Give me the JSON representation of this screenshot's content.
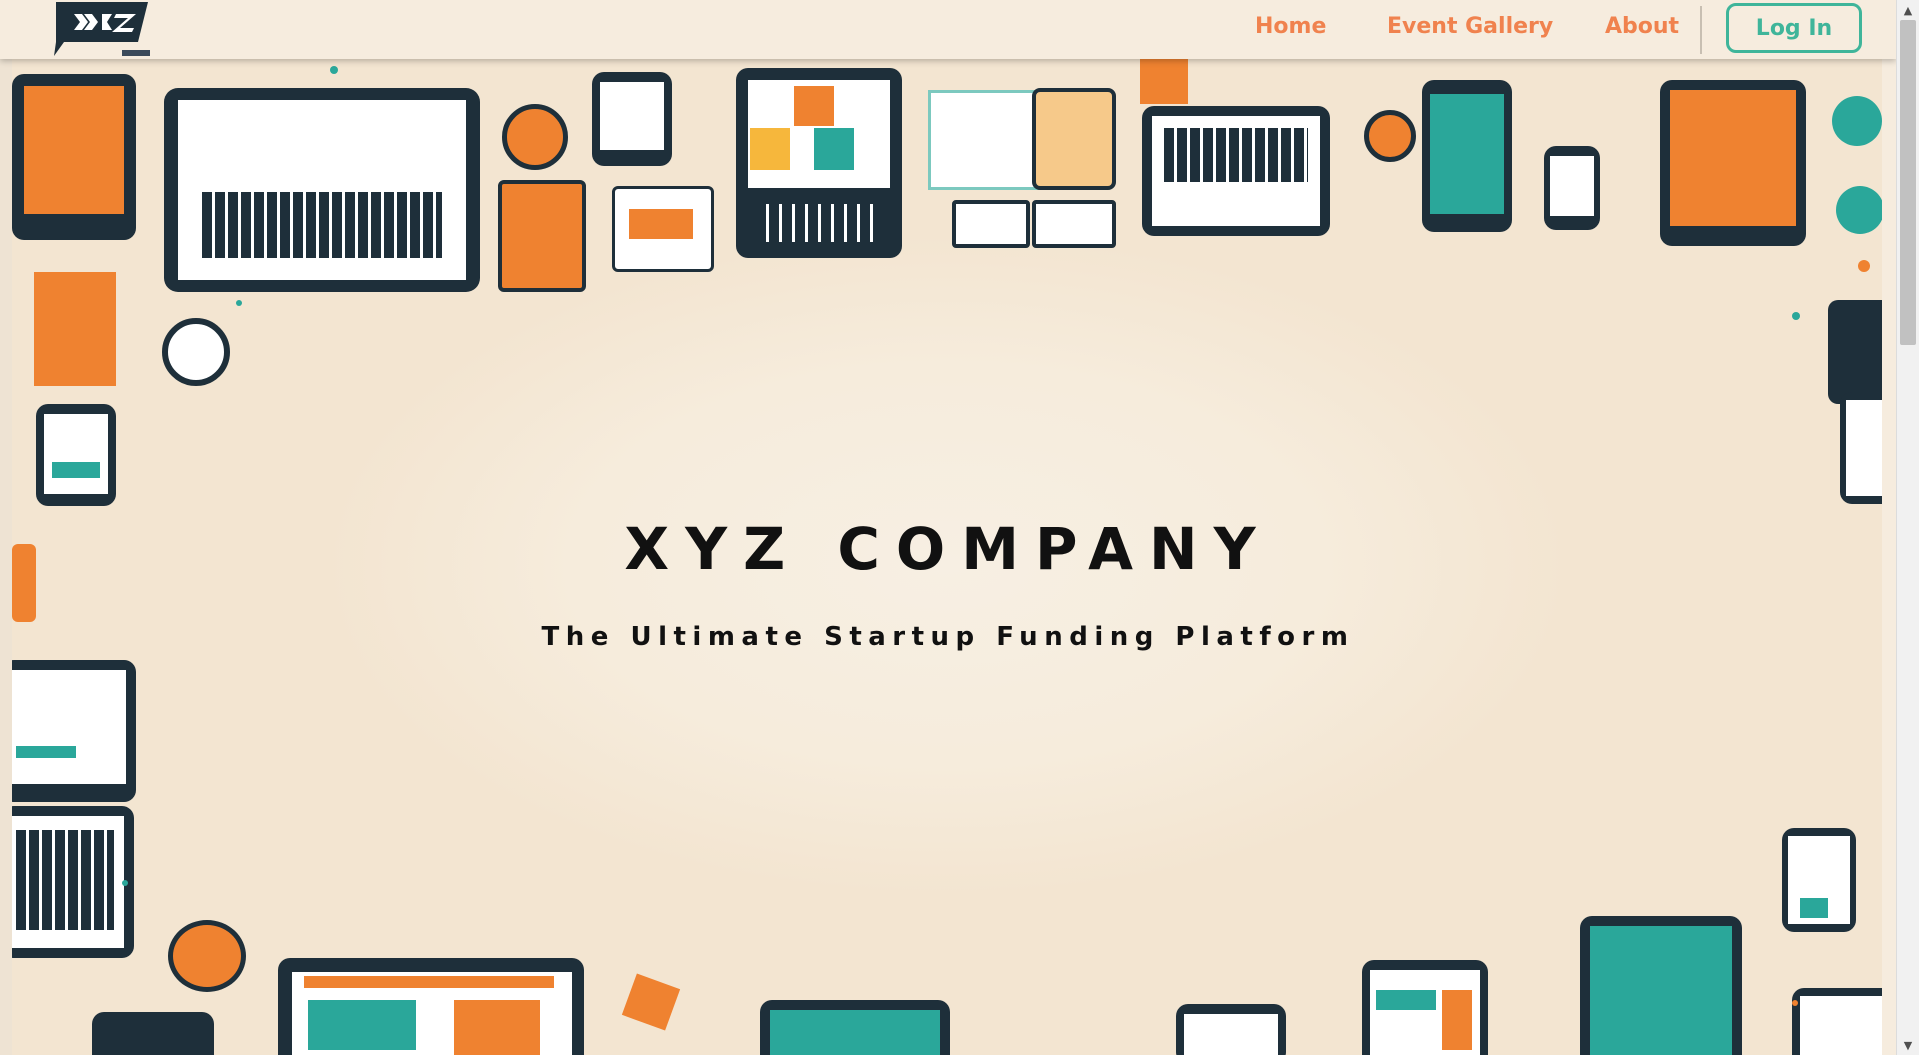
{
  "header": {
    "logo_alt": "XYZ",
    "nav": {
      "home": "Home",
      "event_gallery": "Event Gallery",
      "about": "About"
    },
    "login_label": "Log In"
  },
  "hero": {
    "title": "XYZ COMPANY",
    "subtitle": "The Ultimate Startup Funding Platform"
  },
  "colors": {
    "accent_orange": "#f0824e",
    "accent_teal": "#3fb59a",
    "background": "#f6ecde",
    "dark": "#1e2f3a"
  },
  "icons": {
    "scroll_up": "▲",
    "scroll_down": "▼"
  }
}
